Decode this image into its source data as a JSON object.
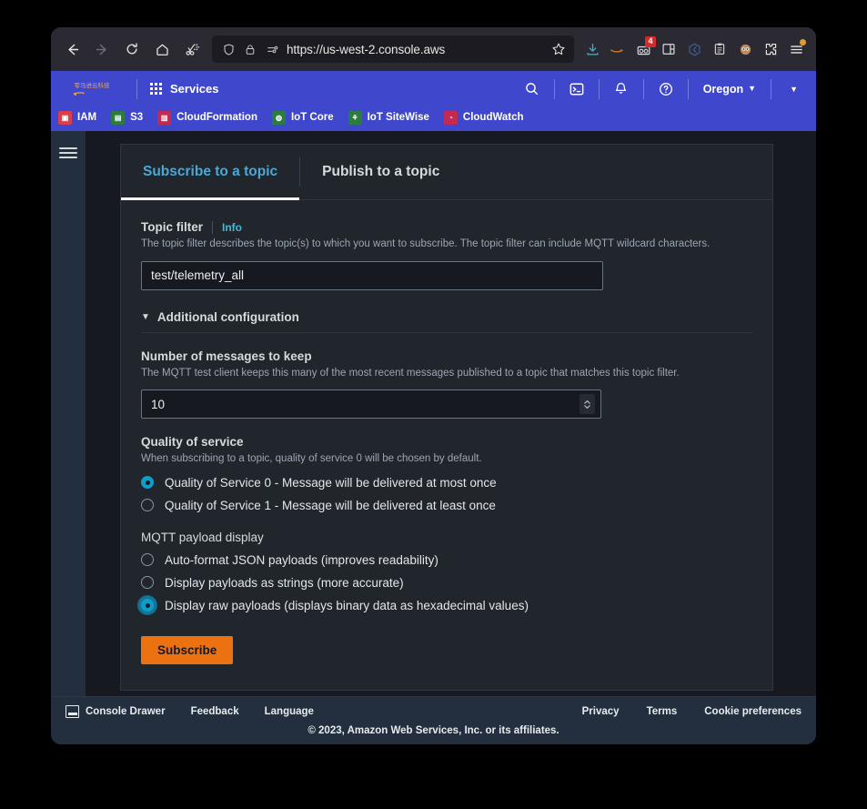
{
  "browser": {
    "url": "https://us-west-2.console.aws",
    "nav": {
      "back": "back-arrow",
      "forward": "forward-arrow",
      "reload": "reload",
      "home": "home",
      "screenshot": "screenshot-scissors"
    },
    "urlbar_icons": {
      "shield": "tracking-protection-shield",
      "lock": "padlock",
      "permissions": "site-permissions",
      "bookmark": "star"
    },
    "extensions": [
      {
        "name": "downloads-icon",
        "badge": ""
      },
      {
        "name": "amazon-smile-icon",
        "badge": ""
      },
      {
        "name": "goggles-extension-icon",
        "badge": "4"
      },
      {
        "name": "window-tiling-icon",
        "badge": ""
      },
      {
        "name": "sidebar-toggle-icon",
        "badge": ""
      },
      {
        "name": "clipboard-extension-icon",
        "badge": ""
      },
      {
        "name": "avatar-extension-icon",
        "badge": ""
      },
      {
        "name": "puzzle-extensions-icon",
        "badge": ""
      },
      {
        "name": "app-menu-icon",
        "badge": ""
      }
    ]
  },
  "aws_nav": {
    "logo_text": "零马进云科技",
    "services_label": "Services",
    "search_icon": "search-icon",
    "cloudshell_icon": "cloudshell-icon",
    "notifications_icon": "bell-icon",
    "help_icon": "help-circle-icon",
    "region_label": "Oregon",
    "region_caret": "▼",
    "account_caret": "▼"
  },
  "favorites": [
    {
      "label": "IAM",
      "color": "#dd3c4a",
      "glyph": "▣"
    },
    {
      "label": "S3",
      "color": "#2a7d3f",
      "glyph": "▤"
    },
    {
      "label": "CloudFormation",
      "color": "#c32a52",
      "glyph": "▥"
    },
    {
      "label": "IoT Core",
      "color": "#2a7d3f",
      "glyph": "◍"
    },
    {
      "label": "IoT SiteWise",
      "color": "#2a7d3f",
      "glyph": "⚘"
    },
    {
      "label": "CloudWatch",
      "color": "#c32a52",
      "glyph": "◔"
    }
  ],
  "sidebar": {
    "menu_icon": "hamburger-menu-icon"
  },
  "tabs": [
    {
      "label": "Subscribe to a topic",
      "active": true
    },
    {
      "label": "Publish to a topic",
      "active": false
    }
  ],
  "form": {
    "topic_filter": {
      "label": "Topic filter",
      "info": "Info",
      "description": "The topic filter describes the topic(s) to which you want to subscribe. The topic filter can include MQTT wildcard characters.",
      "value": "test/telemetry_all",
      "placeholder": "Topic filter"
    },
    "additional_configuration": {
      "label": "Additional configuration",
      "expanded": true,
      "caret": "▼"
    },
    "messages_to_keep": {
      "label": "Number of messages to keep",
      "description": "The MQTT test client keeps this many of the most recent messages published to a topic that matches this topic filter.",
      "value": "10"
    },
    "quality_of_service": {
      "label": "Quality of service",
      "description": "When subscribing to a topic, quality of service 0 will be chosen by default.",
      "options": [
        {
          "label": "Quality of Service 0 - Message will be delivered at most once",
          "selected": true,
          "focused": false
        },
        {
          "label": "Quality of Service 1 - Message will be delivered at least once",
          "selected": false,
          "focused": false
        }
      ]
    },
    "payload_display": {
      "label": "MQTT payload display",
      "options": [
        {
          "label": "Auto-format JSON payloads (improves readability)",
          "selected": false,
          "focused": false
        },
        {
          "label": "Display payloads as strings (more accurate)",
          "selected": false,
          "focused": false
        },
        {
          "label": "Display raw payloads (displays binary data as hexadecimal values)",
          "selected": true,
          "focused": true
        }
      ]
    },
    "submit_label": "Subscribe"
  },
  "footer": {
    "drawer_icon": "console-drawer-icon",
    "left_links": [
      "Console Drawer",
      "Feedback",
      "Language"
    ],
    "right_links": [
      "Privacy",
      "Terms",
      "Cookie preferences"
    ],
    "copyright": "© 2023, Amazon Web Services, Inc. or its affiliates."
  },
  "colors": {
    "aws_nav_blue": "#3f48cc",
    "accent_teal": "#0d9dca",
    "button_orange": "#ec7211",
    "tab_active": "#4aa8d8"
  }
}
